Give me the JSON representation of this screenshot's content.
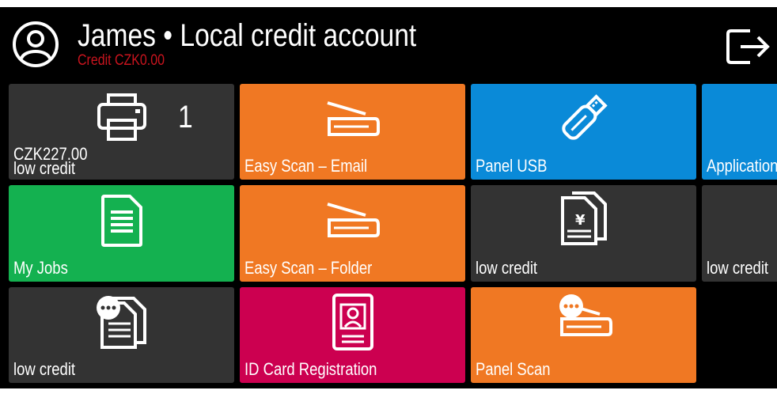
{
  "header": {
    "user_icon": "user-circle-icon",
    "title": "James • Local credit account",
    "credit": "Credit CZK0.00",
    "credit_color": "#c8141e",
    "logout_icon": "logout-icon"
  },
  "tiles": [
    {
      "id": "print",
      "icon": "printer-icon",
      "count": "1",
      "amount": "CZK227.00",
      "status": "low credit",
      "color": "#333333"
    },
    {
      "id": "easy-scan-email",
      "icon": "scanner-icon",
      "label": "Easy Scan – Email",
      "color": "#f07823"
    },
    {
      "id": "panel-usb",
      "icon": "usb-drive-icon",
      "label": "Panel USB",
      "color": "#0a8ad8"
    },
    {
      "id": "applications",
      "icon": "",
      "label": "Applications",
      "color": "#0a8ad8"
    },
    {
      "id": "my-jobs",
      "icon": "document-icon",
      "label": "My Jobs",
      "color": "#14b150"
    },
    {
      "id": "easy-scan-folder",
      "icon": "scanner-icon",
      "label": "Easy Scan – Folder",
      "color": "#f07823"
    },
    {
      "id": "copy",
      "icon": "copy-document-icon",
      "label": "low credit",
      "color": "#333333"
    },
    {
      "id": "partial-low-credit",
      "icon": "",
      "label": "low credit",
      "color": "#333333"
    },
    {
      "id": "copy-options",
      "icon": "copy-options-icon",
      "label": "low credit",
      "color": "#333333"
    },
    {
      "id": "id-card-registration",
      "icon": "id-card-icon",
      "label": "ID Card Registration",
      "color": "#cc0050"
    },
    {
      "id": "panel-scan",
      "icon": "scanner-options-icon",
      "label": "Panel Scan",
      "color": "#f07823"
    }
  ]
}
